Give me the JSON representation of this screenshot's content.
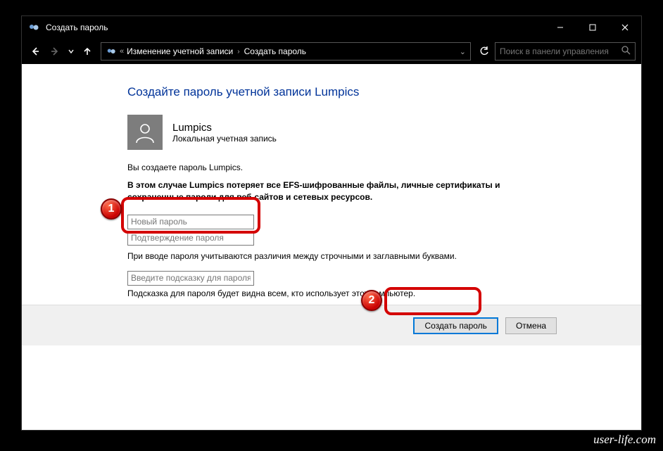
{
  "window": {
    "title": "Создать пароль"
  },
  "nav": {
    "breadcrumb1": "Изменение учетной записи",
    "breadcrumb2": "Создать пароль",
    "search_placeholder": "Поиск в панели управления"
  },
  "page": {
    "heading": "Создайте пароль учетной записи Lumpics",
    "user_name": "Lumpics",
    "user_type": "Локальная учетная запись",
    "info": "Вы создаете пароль Lumpics.",
    "warning": "В этом случае Lumpics потеряет все EFS-шифрованные файлы, личные сертификаты и сохраненные пароли для веб-сайтов и сетевых ресурсов.",
    "pw_placeholder": "Новый пароль",
    "pw_confirm_placeholder": "Подтверждение пароля",
    "case_note": "При вводе пароля учитываются различия между строчными и заглавными буквами.",
    "hint_placeholder": "Введите подсказку для пароля",
    "hint_note": "Подсказка для пароля будет видна всем, кто использует этот компьютер."
  },
  "buttons": {
    "create": "Создать пароль",
    "cancel": "Отмена"
  },
  "annotations": {
    "b1": "1",
    "b2": "2"
  },
  "watermark": "user-life.com"
}
